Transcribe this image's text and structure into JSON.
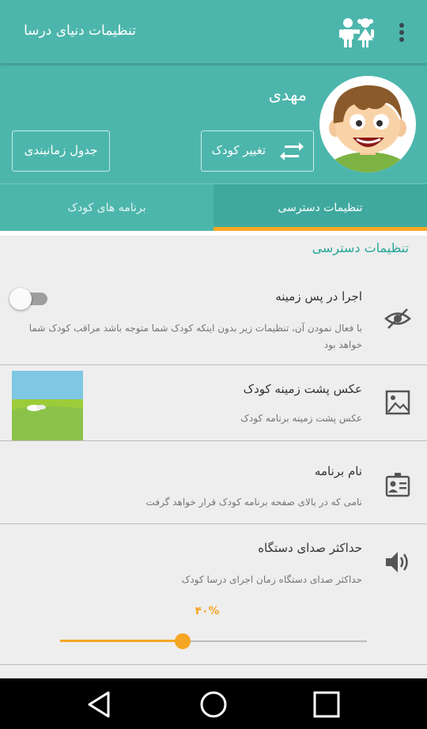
{
  "app": {
    "title": "تنظیمات دنیای درسا"
  },
  "profile": {
    "name": "مهدی",
    "change_child_label": "تغییر کودک",
    "schedule_label": "جدول زمانبندی"
  },
  "tabs": [
    {
      "label": "تنظیمات دسترسی",
      "active": true
    },
    {
      "label": "برنامه های کودک",
      "active": false
    }
  ],
  "section": {
    "title": "تنظیمات دسترسی"
  },
  "settings": [
    {
      "title": "اجرا در پس زمینه",
      "subtitle": "با فعال نمودن آن، تنظیمات زیر بدون اینکه کودک شما متوجه باشد مراقب کودک شما خواهد بود",
      "icon": "eye-icon",
      "toggle_on": false
    },
    {
      "title": "عکس پشت زمینه کودک",
      "subtitle": "عکس پشت زمینه برنامه کودک",
      "icon": "image-icon"
    },
    {
      "title": "نام برنامه",
      "subtitle": "نامی که در بالای صفحه برنامه کودک قرار خواهد گرفت",
      "icon": "id-card-icon"
    },
    {
      "title": "حداکثر صدای دستگاه",
      "subtitle": "حداکثر صدای دستگاه زمان اجرای درسا کودک",
      "icon": "volume-icon",
      "percent_label": "۴۰%",
      "level": 0.4
    }
  ],
  "colors": {
    "primary": "#4db6ac",
    "accent": "#f5a623",
    "tab_indicator": "#f9a825",
    "section_title": "#26a69a"
  },
  "navbar": {
    "icons": [
      "back-icon",
      "home-icon",
      "recents-icon"
    ]
  }
}
